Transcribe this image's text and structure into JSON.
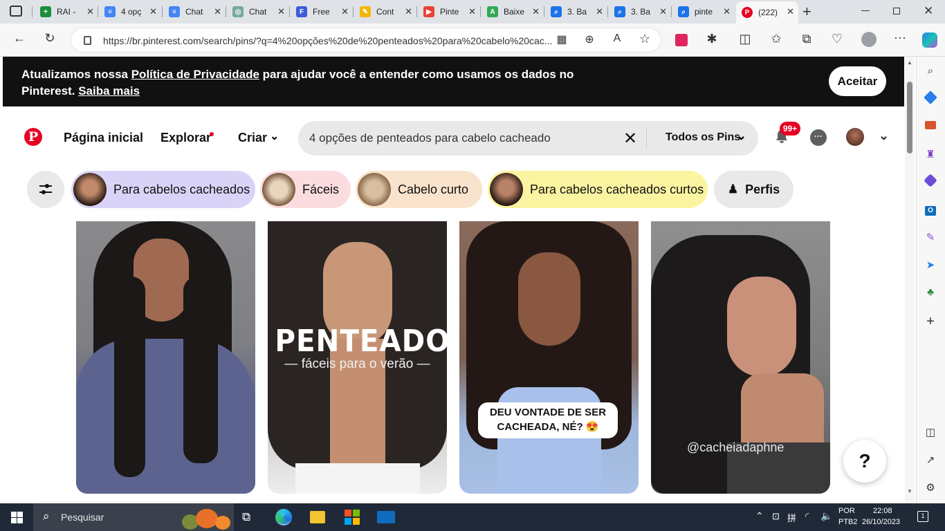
{
  "browser": {
    "tabs": [
      {
        "label": "RAI -",
        "color": "#1e8e3e",
        "glyph": "+"
      },
      {
        "label": "4 opç",
        "color": "#4285f4",
        "glyph": "≡"
      },
      {
        "label": "Chat",
        "color": "#4285f4",
        "glyph": "≡"
      },
      {
        "label": "Chat",
        "color": "#74aa9c",
        "glyph": "◎"
      },
      {
        "label": "Free",
        "color": "#3b5bdb",
        "glyph": "F"
      },
      {
        "label": "Cont",
        "color": "#f4b400",
        "glyph": "✎"
      },
      {
        "label": "Pinte",
        "color": "#ea4335",
        "glyph": "▶"
      },
      {
        "label": "Baixe",
        "color": "#34a853",
        "glyph": "A"
      },
      {
        "label": "3. Ba",
        "color": "#1a73e8",
        "glyph": "⌕"
      },
      {
        "label": "3. Ba",
        "color": "#1a73e8",
        "glyph": "⌕"
      },
      {
        "label": "pinte",
        "color": "#1a73e8",
        "glyph": "⌕"
      },
      {
        "label": "(222)",
        "color": "#e60023",
        "glyph": "P"
      }
    ],
    "url": "https://br.pinterest.com/search/pins/?q=4%20opções%20de%20penteados%20para%20cabelo%20cac..."
  },
  "banner": {
    "pre": "Atualizamos nossa ",
    "link1": "Política de Privacidade",
    "mid": " para ajudar você a entender como usamos os dados no Pinterest. ",
    "link2": "Saiba mais",
    "accept": "Aceitar"
  },
  "header": {
    "logo": "P",
    "home": "Página inicial",
    "explore": "Explorar",
    "create": "Criar",
    "query": "4 opções de penteados para cabelo cacheado",
    "filter": "Todos os Pins",
    "badge": "99+"
  },
  "chips": [
    {
      "label": "Para cabelos cacheados",
      "bg": "#d9d4f7"
    },
    {
      "label": "Fáceis",
      "bg": "#fbdcdf"
    },
    {
      "label": "Cabelo curto",
      "bg": "#f9e3cc"
    },
    {
      "label": "Para cabelos cacheados curtos",
      "bg": "#fbf4a1"
    },
    {
      "label": "Perfis",
      "bg": "#e9e9e9"
    }
  ],
  "pins": [
    {
      "caption": ""
    },
    {
      "title": "PENTEADOS",
      "subtitle": "— fáceis para o verão —"
    },
    {
      "bubble": "DEU VONTADE DE SER CACHEADA, NÉ? 😍"
    },
    {
      "handle": "@cacheiadaphne"
    }
  ],
  "help": "?",
  "taskbar": {
    "search": "Pesquisar",
    "lang1": "POR",
    "lang2": "PTB2",
    "time": "22:08",
    "date": "26/10/2023"
  }
}
